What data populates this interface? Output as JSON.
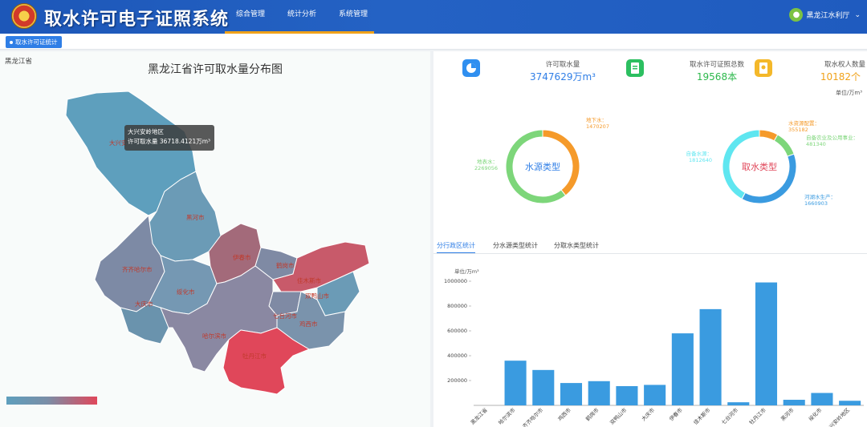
{
  "header": {
    "title": "取水许可电子证照系统",
    "nav": [
      "综合管理",
      "统计分析",
      "系统管理"
    ],
    "user": "黑龙江水利厅"
  },
  "subbar": {
    "tag": "取水许可证统计"
  },
  "map": {
    "province_label": "黑龙江省",
    "title": "黑龙江省许可取水量分布图",
    "tooltip": {
      "region": "大兴安岭地区",
      "text": "许可取水量 36718.4121万m³"
    },
    "labels": [
      {
        "name": "大兴安",
        "color": "#c0392b"
      },
      {
        "name": "黑河市",
        "color": "#c0392b"
      },
      {
        "name": "伊春市",
        "color": "#c0392b"
      },
      {
        "name": "鹤岗市",
        "color": "#c0392b"
      },
      {
        "name": "佳木斯市",
        "color": "#c0392b"
      },
      {
        "name": "齐齐哈尔市",
        "color": "#c0392b"
      },
      {
        "name": "绥化市",
        "color": "#c0392b"
      },
      {
        "name": "大庆市",
        "color": "#c0392b"
      },
      {
        "name": "双鸭山市",
        "color": "#c0392b"
      },
      {
        "name": "七台河市",
        "color": "#c0392b"
      },
      {
        "name": "鸡西市",
        "color": "#c0392b"
      },
      {
        "name": "哈尔滨市",
        "color": "#c0392b"
      },
      {
        "name": "牡丹江市",
        "color": "#c0392b"
      }
    ],
    "legend": {
      "low_color": "#5e9fbd",
      "high_color": "#e0475a"
    }
  },
  "stats": [
    {
      "label": "许可取水量",
      "value": "3747629万m³",
      "color": "#2f7ee6",
      "icon": "pie-chart-icon",
      "icon_color": "#2f8ff0"
    },
    {
      "label": "取水许可证照总数",
      "value": "19568本",
      "color": "#2cb84b",
      "icon": "document-icon",
      "icon_color": "#2cbf60"
    },
    {
      "label": "取水权人数量",
      "value": "10182个",
      "color": "#f0a21a",
      "icon": "person-doc-icon",
      "icon_color": "#f4b82a"
    }
  ],
  "unit_right": "单位/万m³",
  "donuts": [
    {
      "center": "水源类型",
      "center_color": "#2f7ee6",
      "slices": [
        {
          "name": "地下水",
          "value": 1470207,
          "label": "地下水：\n1470207",
          "color": "#f59a2a"
        },
        {
          "name": "地表水",
          "value": 2269056,
          "label": "地表水：\n2269056",
          "color": "#7dd67a"
        }
      ]
    },
    {
      "center": "取水类型",
      "center_color": "#e0475a",
      "slices": [
        {
          "name": "水资源配置",
          "value": 355182,
          "label": "水资源配置：\n355182",
          "color": "#f59a2a"
        },
        {
          "name": "自备水源城乡公用事业",
          "value": 481340,
          "label": "自备农业及公用事业：\n481340",
          "color": "#7dd67a"
        },
        {
          "name": "河湖水生产",
          "value": 1660903,
          "label": "河湖水生产：\n1660903",
          "color": "#3a9be0"
        },
        {
          "name": "自备水源",
          "value": 1812640,
          "label": "自备水源：\n1812640",
          "color": "#5fe6f0"
        }
      ]
    }
  ],
  "tabs": [
    "分行政区统计",
    "分水源类型统计",
    "分取水类型统计"
  ],
  "chart_data": {
    "type": "bar",
    "ylabel": "单位/万m³",
    "ylim": [
      0,
      1000000
    ],
    "yticks": [
      200000,
      400000,
      600000,
      800000,
      1000000
    ],
    "categories": [
      "黑龙江省",
      "哈尔滨市",
      "齐齐哈尔市",
      "鸡西市",
      "鹤岗市",
      "双鸭山市",
      "大庆市",
      "伊春市",
      "佳木斯市",
      "七台河市",
      "牡丹江市",
      "黑河市",
      "绥化市",
      "大兴安岭地区"
    ],
    "values": [
      0,
      360000,
      285000,
      180000,
      195000,
      155000,
      165000,
      580000,
      775000,
      25000,
      990000,
      45000,
      100000,
      37000
    ],
    "color": "#3a9be0"
  }
}
